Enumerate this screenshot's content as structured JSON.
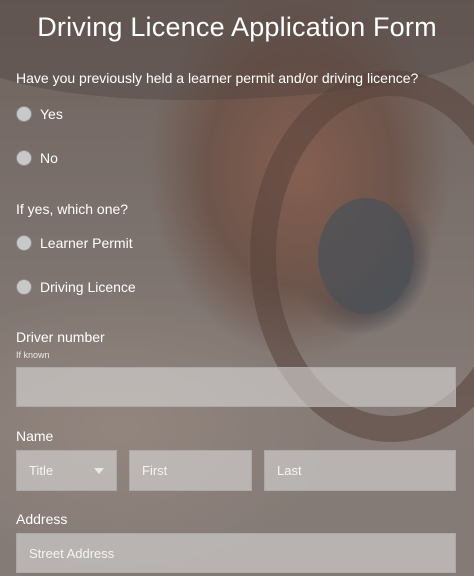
{
  "form": {
    "title": "Driving Licence Application Form",
    "q1": {
      "question": "Have you previously held a learner permit and/or driving licence?",
      "options": [
        "Yes",
        "No"
      ]
    },
    "q2": {
      "question": "If yes, which one?",
      "options": [
        "Learner Permit",
        "Driving Licence"
      ]
    },
    "driver_number": {
      "label": "Driver number",
      "hint": "If known",
      "value": "",
      "placeholder": ""
    },
    "name": {
      "label": "Name",
      "title_placeholder": "Title",
      "first_placeholder": "First",
      "last_placeholder": "Last"
    },
    "address": {
      "label": "Address",
      "street_placeholder": "Street Address"
    }
  }
}
